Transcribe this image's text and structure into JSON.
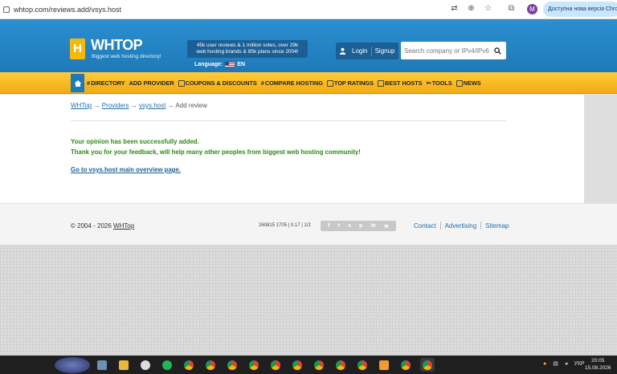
{
  "browser": {
    "url": "whtop.com/reviews.add/vsys.host",
    "profile_initial": "M",
    "update_label": "Доступна нова версія Chrome"
  },
  "header": {
    "logo_mark": "H",
    "logo_text": "WHTOP",
    "tagline": "Biggest web hosting directory!",
    "stats_line1": "45k user reviews & 1 million votes, over 29k",
    "stats_line2": "web hosting brands & 85k plans since 2004!",
    "language_label": "Language:",
    "language_code": "EN",
    "login": "Login",
    "signup": "Signup",
    "search_placeholder": "Search company or IPv4/IPv6"
  },
  "nav": {
    "items": [
      {
        "label": "DIRECTORY",
        "icon": "hash-icon"
      },
      {
        "label": "ADD PROVIDER",
        "icon": ""
      },
      {
        "label": "COUPONS & DISCOUNTS",
        "icon": "coupon-icon"
      },
      {
        "label": "COMPARE HOSTING",
        "icon": "hash-icon"
      },
      {
        "label": "TOP RATINGS",
        "icon": "ratings-icon"
      },
      {
        "label": "BEST HOSTS",
        "icon": "best-hosts-icon"
      },
      {
        "label": "TOOLS",
        "icon": "tools-icon"
      },
      {
        "label": "NEWS",
        "icon": "news-icon"
      }
    ]
  },
  "breadcrumb": {
    "home": "WHTop",
    "providers": "Providers",
    "host": "vsys.host",
    "current": "Add review",
    "arrow": "→"
  },
  "message": {
    "line1": "Your opinion has been successfully added.",
    "line2": "Thank you for your feedback, will help many other peoples from biggest web hosting community!",
    "link": "Go to vsys.host main overview page."
  },
  "footer": {
    "copyright": "© 2004 - 2026 ",
    "brand": "WHTop",
    "perf": "260815 1705 | 0.17 | 1/2",
    "links": [
      "Contact",
      "Advertising",
      "Sitemap"
    ]
  },
  "taskbar": {
    "lang": "УКР",
    "time": "20:05",
    "date": "15.08.2026"
  },
  "colors": {
    "header_blue": "#2b8fd0",
    "nav_orange": "#f1ab12",
    "success_green": "#2c8a14",
    "link_blue": "#1f6fae"
  }
}
